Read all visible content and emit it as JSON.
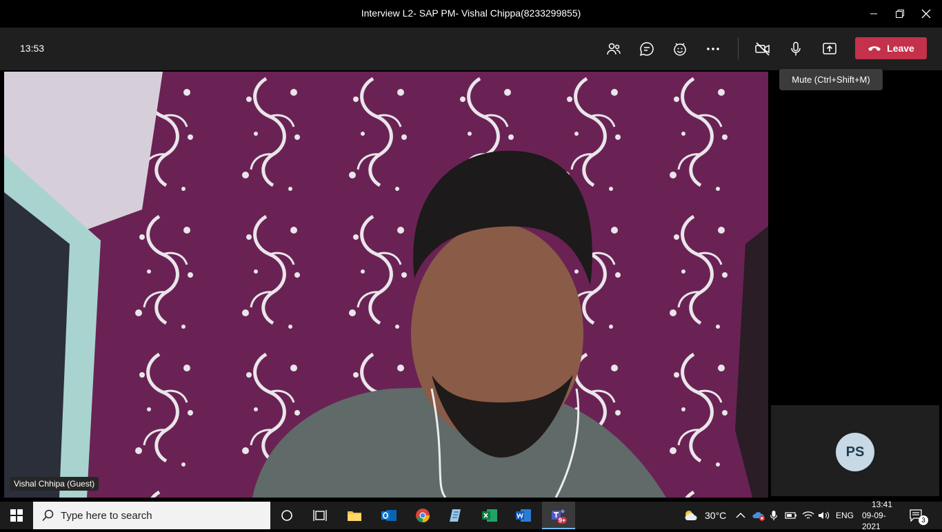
{
  "window": {
    "title": "Interview L2- SAP PM- Vishal Chippa(8233299855)"
  },
  "meeting": {
    "elapsed_time": "13:53",
    "leave_label": "Leave",
    "tooltip": "Mute (Ctrl+Shift+M)",
    "participant_name": "Vishal Chhipa (Guest)",
    "self_initials": "PS",
    "icons": [
      "participants-icon",
      "chat-icon",
      "reactions-icon",
      "more-icon",
      "camera-off-icon",
      "microphone-icon",
      "share-icon",
      "hang-up-icon"
    ]
  },
  "taskbar": {
    "search_placeholder": "Type here to search",
    "weather": "30°C",
    "language": "ENG",
    "time": "13:41",
    "date": "09-09-2021",
    "notification_count": "3",
    "teams_badge": "9+",
    "apps": [
      "task-view",
      "file-explorer",
      "outlook",
      "chrome",
      "notepad",
      "excel",
      "word",
      "teams"
    ]
  },
  "colors": {
    "leave": "#c4314b",
    "wallpaper": "#6a2254",
    "accent_blue": "#0078d4"
  }
}
